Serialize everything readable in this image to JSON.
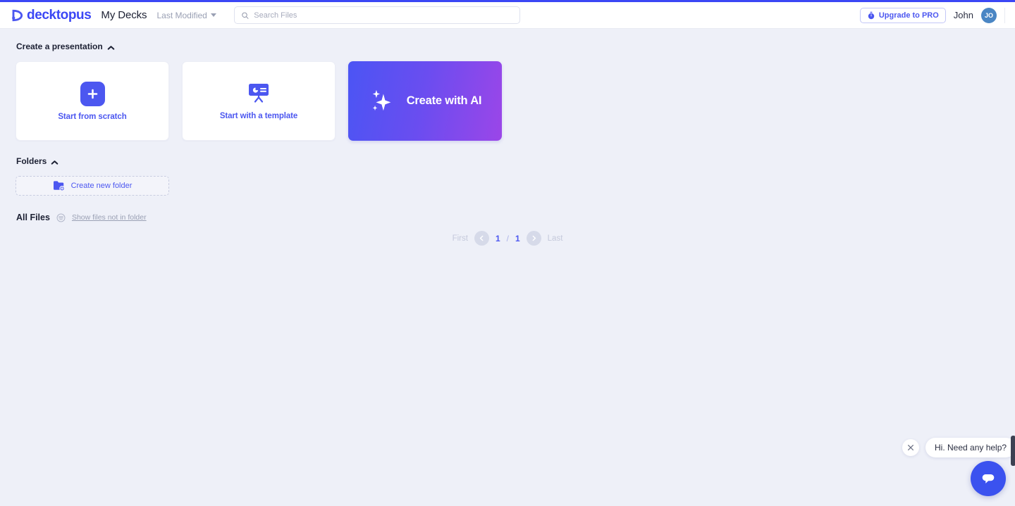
{
  "brand": {
    "name": "decktopus",
    "logo_icon": "decktopus-logo-icon",
    "accent": "#4c57f0"
  },
  "header": {
    "nav_title": "My Decks",
    "sort": {
      "label": "Last Modified",
      "icon": "chevron-down-icon"
    },
    "search": {
      "placeholder": "Search Files",
      "value": "",
      "icon": "search-icon"
    },
    "upgrade": {
      "label": "Upgrade to PRO",
      "icon": "stopwatch-icon"
    },
    "user": {
      "name": "John",
      "initials": "JO",
      "avatar_color": "#4a86c4"
    }
  },
  "create_section": {
    "title": "Create a presentation",
    "collapse_icon": "chevron-up-icon",
    "cards": [
      {
        "label": "Start from scratch",
        "icon": "plus-icon"
      },
      {
        "label": "Start with a template",
        "icon": "presentation-board-icon"
      },
      {
        "label": "Create with AI",
        "icon": "sparkles-icon",
        "gradient_from": "#4b55f4",
        "gradient_to": "#9b46e8"
      }
    ]
  },
  "folders_section": {
    "title": "Folders",
    "collapse_icon": "chevron-up-icon",
    "create_folder": {
      "label": "Create new folder",
      "icon": "folder-plus-icon"
    }
  },
  "all_files_section": {
    "title": "All Files",
    "filter_icon": "filter-lines-icon",
    "toggle_label": "Show files not in folder"
  },
  "pagination": {
    "first_label": "First",
    "prev_icon": "chevron-left-icon",
    "current_page": "1",
    "separator": "/",
    "total_pages": "1",
    "next_icon": "chevron-right-icon",
    "last_label": "Last"
  },
  "chat_widget": {
    "message": "Hi. Need any help?",
    "close_icon": "close-icon",
    "fab_icon": "chat-bubble-icon",
    "fab_color": "#3b52ef"
  }
}
